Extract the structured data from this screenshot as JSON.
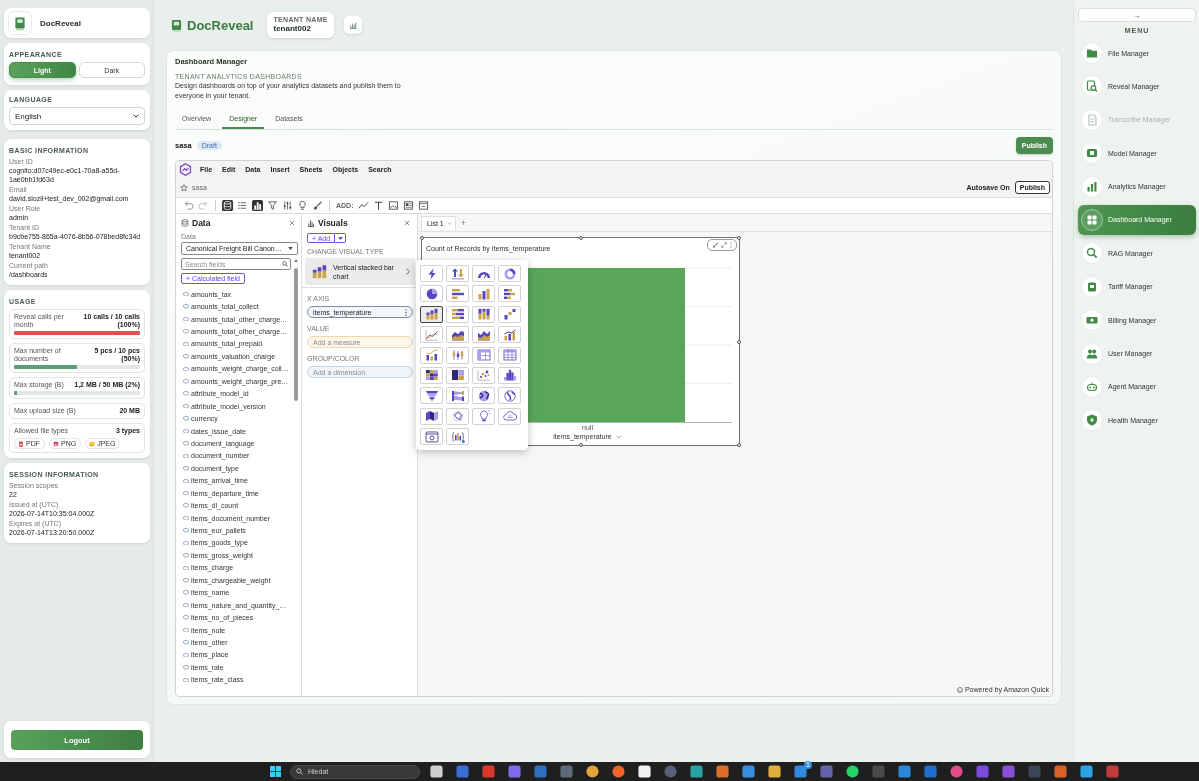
{
  "sidebar_left": {
    "brand": "DocReveal",
    "appearance": {
      "title": "APPEARANCE",
      "options": [
        {
          "label": "Light",
          "selected": true
        },
        {
          "label": "Dark",
          "selected": false
        }
      ]
    },
    "language": {
      "title": "LANGUAGE",
      "value": "English"
    },
    "basic_information": {
      "title": "BASIC INFORMATION",
      "items": [
        {
          "label": "User ID",
          "value": "cognito:d07c49ec-e0c1-70a8-a55d-1ae0bb1fd63d"
        },
        {
          "label": "Email",
          "value": "david.slozil+test_dev_002@gmail.com"
        },
        {
          "label": "User Role",
          "value": "admin"
        },
        {
          "label": "Tenant ID",
          "value": "b9cbe755-865a-4076-8b56-078bed8fc34d"
        },
        {
          "label": "Tenant Name",
          "value": "tenant002"
        },
        {
          "label": "Current path",
          "value": "/dashboards"
        }
      ]
    },
    "usage": {
      "title": "USAGE",
      "items": [
        {
          "kind": "meter",
          "label": "Reveal calls per month",
          "value": "10 calls / 10 calls (100%)",
          "level": 1,
          "color": "#d9534f"
        },
        {
          "kind": "meter",
          "label": "Max number of documents",
          "value": "5 pcs / 10 pcs (50%)",
          "level": 0.5,
          "color": "#5c9e76"
        },
        {
          "kind": "meter",
          "label": "Max storage (B)",
          "value": "1,2 MB / 50 MB (2%)",
          "level": 0.02,
          "color": "#5c9e76"
        },
        {
          "kind": "plain",
          "label": "Max upload size (B)",
          "value": "20 MB"
        },
        {
          "kind": "file_types",
          "label": "Allowed file types",
          "value": "3 types",
          "types": [
            {
              "label": "PDF"
            },
            {
              "label": "PNG"
            },
            {
              "label": "JPEG"
            }
          ]
        }
      ]
    },
    "session_information": {
      "title": "SESSION INFORMATION",
      "items": [
        {
          "label": "Session scopes",
          "value": "22"
        },
        {
          "label": "Issued at (UTC)",
          "value": "2026-07-14T10:35:04.000Z"
        },
        {
          "label": "Expires at (UTC)",
          "value": "2026-07-14T13:20:50.000Z"
        }
      ]
    },
    "logout": "Logout"
  },
  "header": {
    "brand": "DocReveal",
    "tenant_label": "TENANT NAME",
    "tenant_name": "tenant002"
  },
  "page": {
    "title": "Dashboard Manager",
    "eyebrow": "TENANT ANALYTICS DASHBOARDS",
    "description": "Design dashboards on top of your analytics datasets and publish them to everyone in your tenant.",
    "tabs": [
      {
        "label": "Overview",
        "selected": false
      },
      {
        "label": "Designer",
        "selected": true
      },
      {
        "label": "Datasets",
        "selected": false
      }
    ],
    "dashboard_name": "sasa",
    "status": "Draft",
    "publish": "Publish"
  },
  "designer": {
    "menu": [
      "File",
      "Edit",
      "Data",
      "Insert",
      "Sheets",
      "Objects",
      "Search"
    ],
    "analysis_name": "sasa",
    "autosave": "Autosave On",
    "publish": "Publish",
    "add_label": "ADD:",
    "pane_toggles": [
      {
        "selected": true
      },
      {
        "selected": false
      },
      {
        "selected": true
      },
      {
        "selected": false
      },
      {
        "selected": false
      },
      {
        "selected": false
      },
      {
        "selected": false
      }
    ],
    "data_pane": {
      "title": "Data",
      "dataset_label": "Data",
      "dataset": "Canonical Freight Bill Canon…",
      "search_placeholder": "Search fields",
      "calculated_field": "+ Calculated field",
      "fields": [
        "amounts_tax",
        "amounts_total_collect",
        "amounts_total_other_charge…",
        "amounts_total_other_charge…",
        "amounts_total_prepaid",
        "amounts_valuation_charge",
        "amounts_weight_charge_coll…",
        "amounts_weight_charge_pre…",
        "attribute_model_id",
        "attribute_model_version",
        "currency",
        "dates_issue_date",
        "document_language",
        "document_number",
        "document_type",
        "items_arrival_time",
        "items_departure_time",
        "items_dl_count",
        "items_document_number",
        "items_eur_pallets",
        "items_goods_type",
        "items_gross_weight",
        "items_charge",
        "items_chargeable_weight",
        "items_name",
        "items_nature_and_quantity_…",
        "items_no_of_pieces",
        "items_note",
        "items_other",
        "items_place",
        "items_rate",
        "items_rate_class"
      ]
    },
    "visuals_pane": {
      "title": "Visuals",
      "add": "+ Add",
      "change_type_label": "CHANGE VISUAL TYPE",
      "current_type": "Vertical stacked bar chart",
      "wells": [
        {
          "kind": "filled",
          "label": "X AXIS",
          "value": "items_temperature"
        },
        {
          "kind": "measure",
          "label": "VALUE",
          "placeholder": "Add a measure"
        },
        {
          "kind": "dimension",
          "label": "GROUP/COLOR",
          "placeholder": "Add a dimension"
        }
      ]
    },
    "sheet_tabs": [
      {
        "label": "List 1",
        "selected": true
      }
    ],
    "add_sheet": "+",
    "visual": {
      "title": "Count of Records by Items_temperature",
      "category": "null",
      "x_axis_title": "items_temperature"
    },
    "visual_types": [
      {
        "selected": false
      },
      {
        "selected": false
      },
      {
        "selected": false
      },
      {
        "selected": false
      },
      {
        "selected": false
      },
      {
        "selected": false
      },
      {
        "selected": false
      },
      {
        "selected": false
      },
      {
        "selected": true
      },
      {
        "selected": false
      },
      {
        "selected": false
      },
      {
        "selected": false
      },
      {
        "selected": false
      },
      {
        "selected": false
      },
      {
        "selected": false
      },
      {
        "selected": false
      },
      {
        "selected": false
      },
      {
        "selected": false
      },
      {
        "selected": false
      },
      {
        "selected": false
      },
      {
        "selected": false
      },
      {
        "selected": false
      },
      {
        "selected": false
      },
      {
        "selected": false
      },
      {
        "selected": false
      },
      {
        "selected": false
      },
      {
        "selected": false
      },
      {
        "selected": false
      },
      {
        "selected": false
      },
      {
        "selected": false
      },
      {
        "selected": false
      },
      {
        "selected": false
      },
      {
        "selected": false
      },
      {
        "selected": false
      }
    ],
    "footer": "Powered by Amazon Quick"
  },
  "menu_right": {
    "collapse": "→",
    "title": "MENU",
    "items": [
      {
        "label": "File Manager",
        "selected": false,
        "disabled": false
      },
      {
        "label": "Reveal Manager",
        "selected": false,
        "disabled": false
      },
      {
        "label": "Transcribe Manager",
        "selected": false,
        "disabled": true
      },
      {
        "label": "Model Manager",
        "selected": false,
        "disabled": false
      },
      {
        "label": "Analytics Manager",
        "selected": false,
        "disabled": false
      },
      {
        "label": "Dashboard Manager",
        "selected": true,
        "disabled": false
      },
      {
        "label": "RAG Manager",
        "selected": false,
        "disabled": false
      },
      {
        "label": "Tariff Manager",
        "selected": false,
        "disabled": false
      },
      {
        "label": "Billing Manager",
        "selected": false,
        "disabled": false
      },
      {
        "label": "User Manager",
        "selected": false,
        "disabled": false
      },
      {
        "label": "Agent Manager",
        "selected": false,
        "disabled": false
      },
      {
        "label": "Health Manager",
        "selected": false,
        "disabled": false
      }
    ]
  },
  "taskbar": {
    "search_placeholder": "Hledat",
    "badge": "1"
  }
}
